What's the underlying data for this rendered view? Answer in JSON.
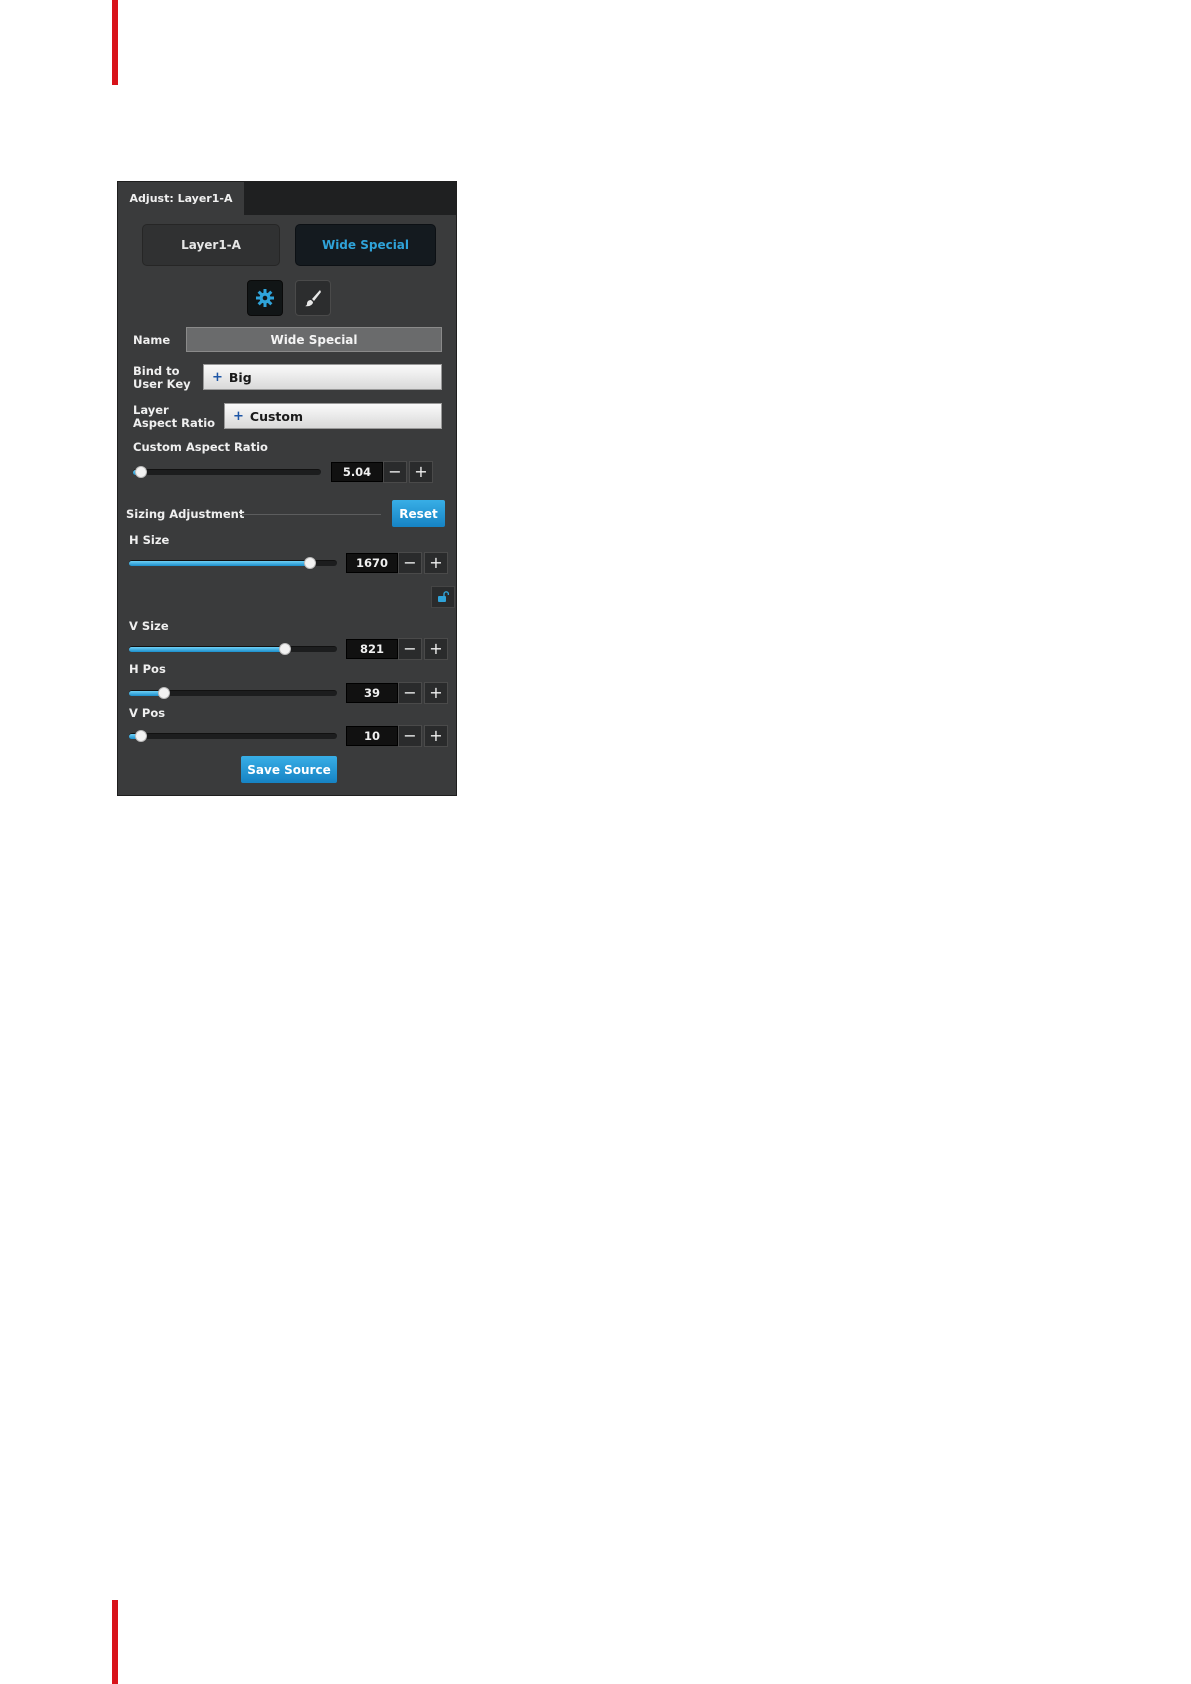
{
  "panel": {
    "tab_title": "Adjust: Layer1-A",
    "segments": {
      "left": "Layer1-A",
      "right": "Wide Special"
    },
    "icons": {
      "settings": "gear-icon",
      "appearance": "brush-icon",
      "lock": "unlock-icon"
    },
    "fields": {
      "name_label": "Name",
      "name_value": "Wide Special",
      "bind_label_1": "Bind to",
      "bind_label_2": "User Key",
      "bind_value": "Big",
      "aspect_label_1": "Layer",
      "aspect_label_2": "Aspect Ratio",
      "aspect_value": "Custom",
      "plus_glyph": "+"
    },
    "custom_aspect": {
      "label": "Custom Aspect Ratio",
      "value": "5.04",
      "fraction": 0.04
    },
    "sizing": {
      "title": "Sizing Adjustment",
      "reset_label": "Reset",
      "h_size": {
        "label": "H Size",
        "value": "1670",
        "fraction": 0.87
      },
      "v_size": {
        "label": "V Size",
        "value": "821",
        "fraction": 0.75
      },
      "h_pos": {
        "label": "H Pos",
        "value": "39",
        "fraction": 0.17
      },
      "v_pos": {
        "label": "V Pos",
        "value": "10",
        "fraction": 0.06
      }
    },
    "step_minus": "−",
    "step_plus": "+",
    "save_label": "Save Source"
  },
  "colors": {
    "accent": "#1b8fcc",
    "brand_bar": "#d8131a",
    "panel_bg": "#3a3b3c"
  }
}
